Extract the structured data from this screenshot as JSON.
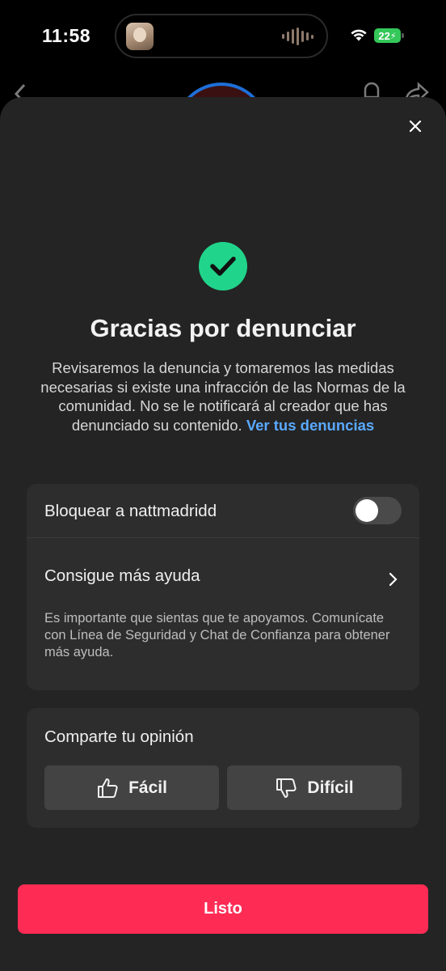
{
  "status_bar": {
    "time": "11:58",
    "battery": "22",
    "icons": [
      "wifi-icon",
      "battery-icon",
      "audio-waveform-icon"
    ]
  },
  "sheet": {
    "title": "Gracias por denunciar",
    "description": "Revisaremos la denuncia y tomaremos las medidas necesarias si existe una infracción de las Normas de la comunidad. No se le notificará al creador que has denunciado su contenido.",
    "reports_link": "Ver tus denuncias",
    "block_label": "Bloquear a nattmadridd",
    "block_enabled": false,
    "help_label": "Consigue más ayuda",
    "help_text": "Es importante que sientas que te apoyamos. Comunícate con Línea de Seguridad y Chat de Confianza para obtener más ayuda.",
    "opinion_title": "Comparte tu opinión",
    "easy_label": "Fácil",
    "hard_label": "Difícil",
    "done_label": "Listo"
  },
  "colors": {
    "accent_green": "#20d58b",
    "link_blue": "#5aa9ff",
    "primary_button": "#fe2c55",
    "sheet_bg": "#242424",
    "card_bg": "#2d2d2d"
  }
}
